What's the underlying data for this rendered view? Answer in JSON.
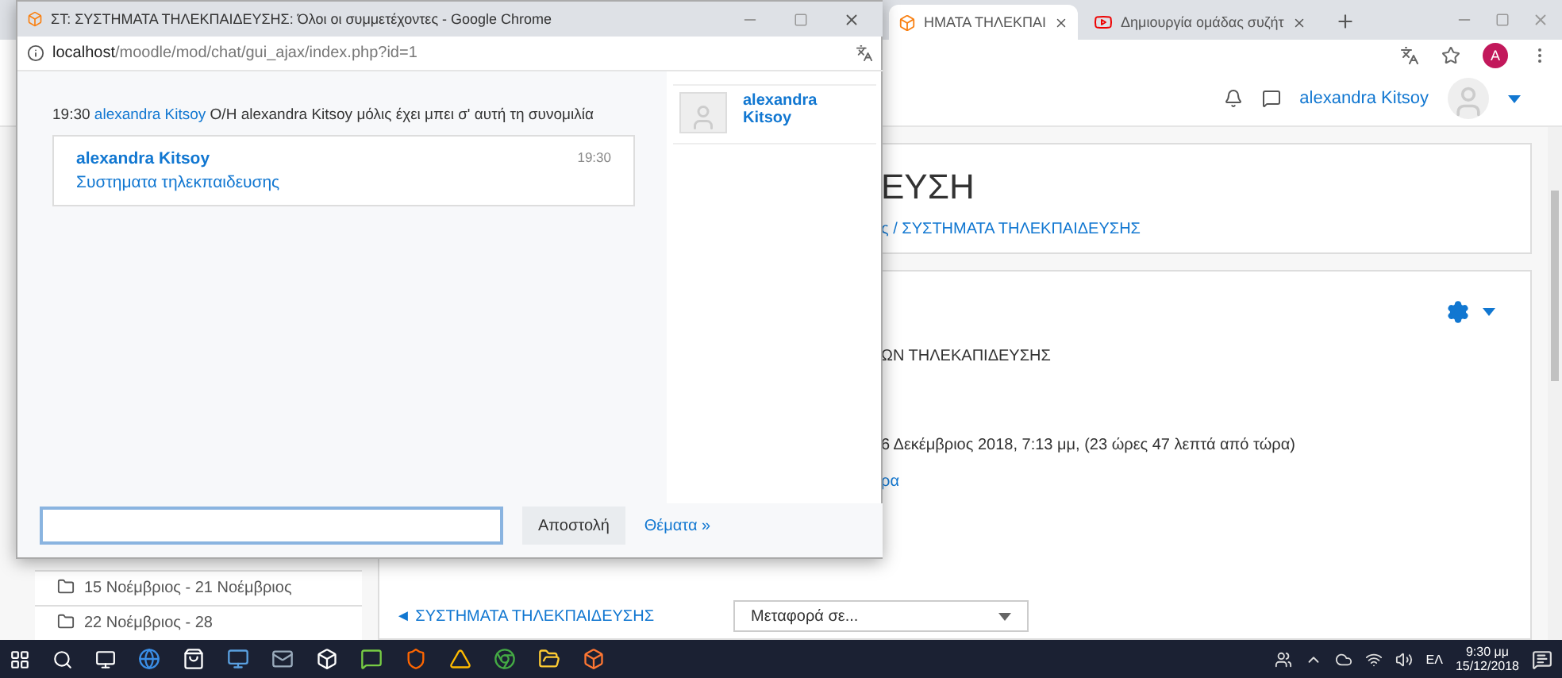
{
  "browser": {
    "tabs": [
      {
        "title": "ΗΜΑΤΑ ΤΗΛΕΚΠΑΙ",
        "kind": "moodle",
        "selected": true
      },
      {
        "title": "Δημιουργία ομάδας συζήτ",
        "kind": "youtube",
        "selected": false
      }
    ],
    "profile_initial": "A"
  },
  "moodle": {
    "user_name": "alexandra Kitsoy",
    "heading": "ΕΥΣΗ",
    "breadcrumb": "ς / ΣΥΣΤΗΜΑΤΑ ΤΗΛΕΚΠΑΙΔΕΥΣΗΣ",
    "section_title": "ΩΝ ΤΗΛΕΚΑΠΙΔΕΥΣΗΣ",
    "next_session": "6 Δεκέμβριος 2018, 7:13 μμ, (23 ώρες 47 λεπτά από τώρα)",
    "link": "ρα",
    "prev_link": "◄ ΣΥΣΤΗΜΑΤΑ ΤΗΛΕΚΠΑΙΔΕΥΣΗΣ",
    "jump_select": "Μεταφορά σε...",
    "sidebar": {
      "items": [
        {
          "label": "15 Νοέμβριος - 21 Νοέμβριος"
        },
        {
          "label": "22 Νοέμβριος - 28"
        }
      ]
    }
  },
  "chat_window": {
    "title": "ΣΤ: ΣΥΣΤΗΜΑΤΑ ΤΗΛΕΚΠΑΙΔΕΥΣΗΣ: Όλοι οι συμμετέχοντες - Google Chrome",
    "url_host": "localhost",
    "url_path": "/moodle/mod/chat/gui_ajax/index.php?id=1",
    "system_message": {
      "time": "19:30",
      "user": "alexandra Kitsoy",
      "text": "O/H alexandra Kitsoy μόλις έχει μπει σ' αυτή τη συνομιλία"
    },
    "messages": [
      {
        "user": "alexandra Kitsoy",
        "time": "19:30",
        "text": "Συστηματα τηλεκπαιδευσης"
      }
    ],
    "users": [
      {
        "name": "alexandra Kitsoy"
      }
    ],
    "send_button": "Αποστολή",
    "themes_link": "Θέματα »"
  },
  "taskbar": {
    "language": "ΕΛ",
    "time": "9:30 μμ",
    "date": "15/12/2018"
  }
}
